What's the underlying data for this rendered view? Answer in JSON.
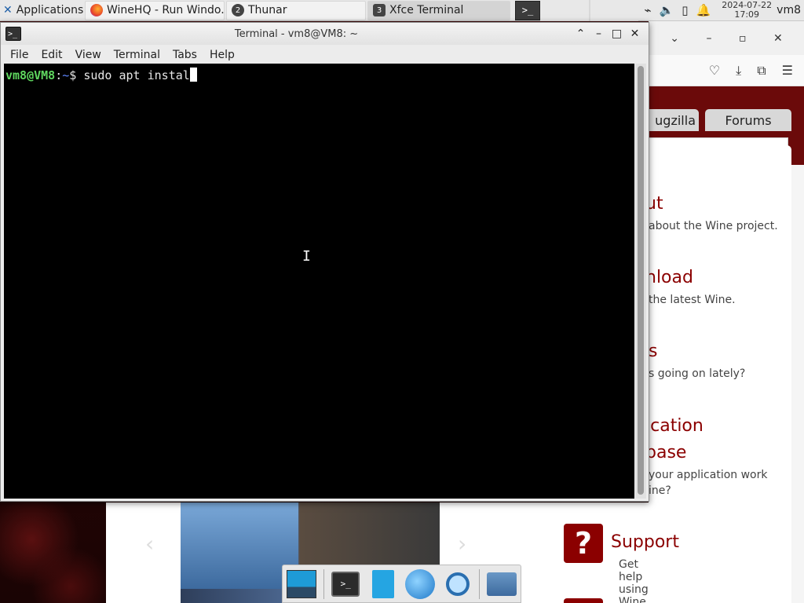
{
  "top_panel": {
    "applications_label": "Applications",
    "tasks": [
      {
        "label": "WineHQ - Run Windo...",
        "icon": "firefox-icon"
      },
      {
        "label": "Thunar",
        "badge": "2",
        "icon": "thunar-icon"
      },
      {
        "label": "Xfce Terminal",
        "badge": "3",
        "icon": "terminal-icon"
      }
    ],
    "workspace_label": ">_",
    "clock_date": "2024-07-22",
    "clock_time": "17:09",
    "user": "vm8"
  },
  "terminal": {
    "title": "Terminal - vm8@VM8: ~",
    "menu": [
      "File",
      "Edit",
      "View",
      "Terminal",
      "Tabs",
      "Help"
    ],
    "prompt_user": "vm8@VM8",
    "prompt_sep": ":",
    "prompt_path": "~",
    "prompt_symbol": "$ ",
    "command": "sudo apt instal"
  },
  "browser": {
    "tab_bugzilla": "ugzilla",
    "tab_forums": "Forums",
    "sections": [
      {
        "heading": "ut",
        "sub": "about the Wine project."
      },
      {
        "heading": "nload",
        "sub": "the latest Wine."
      },
      {
        "heading": "s",
        "sub": "s going on lately?"
      },
      {
        "heading_line1": "ication",
        "heading_line2": "base",
        "sub_line1": "your application work",
        "sub_line2": "ine?"
      }
    ],
    "support_heading": "Support",
    "support_sub": "Get help using Wine.",
    "support_icon": "?"
  },
  "colors": {
    "wine_red": "#8b0000",
    "prompt_green": "#5fd75f",
    "prompt_blue": "#5f87ff"
  }
}
